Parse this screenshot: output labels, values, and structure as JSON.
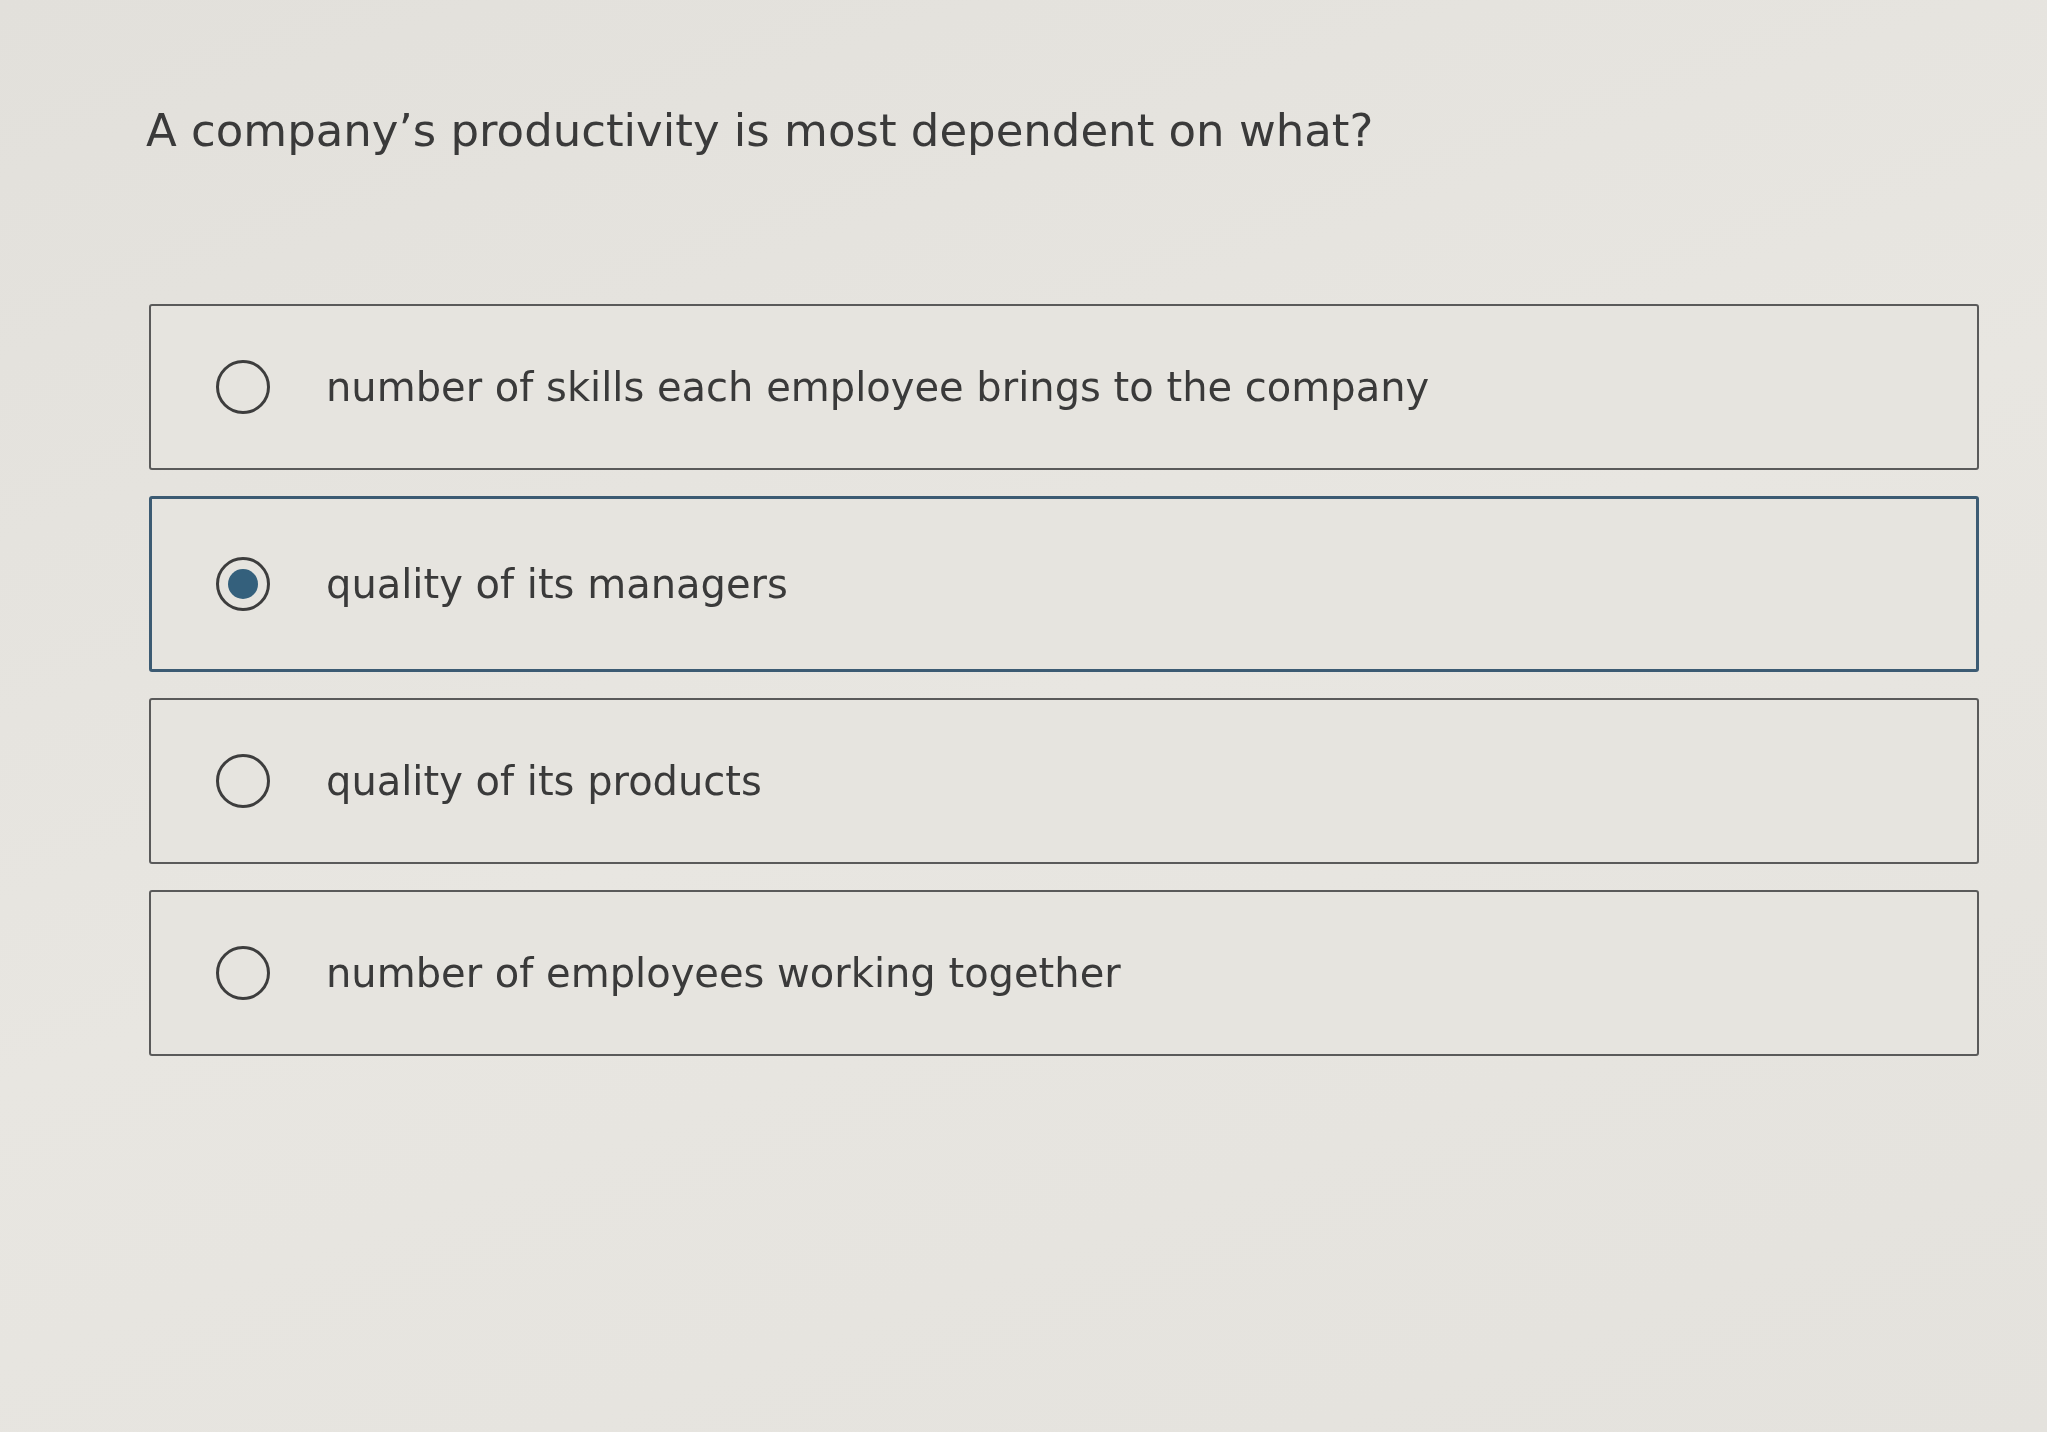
{
  "question": "A company’s productivity is most dependent on what?",
  "options": [
    {
      "label": "number of skills each employee brings to the company",
      "selected": false
    },
    {
      "label": "quality of its managers",
      "selected": true
    },
    {
      "label": "quality of its products",
      "selected": false
    },
    {
      "label": "number of employees working together",
      "selected": false
    }
  ]
}
